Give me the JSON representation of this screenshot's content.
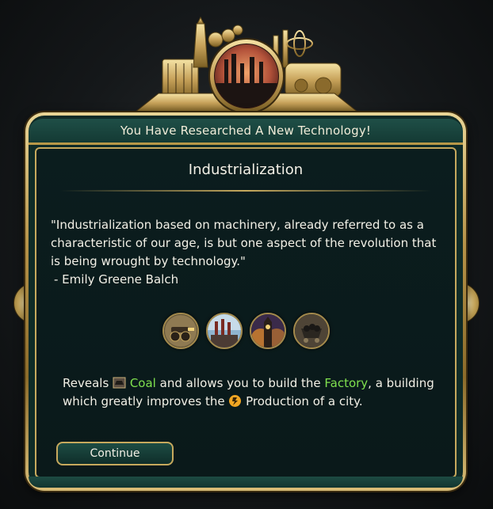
{
  "header": {
    "title": "You Have Researched A New Technology!"
  },
  "tech": {
    "name": "Industrialization"
  },
  "quote": {
    "text": "\"Industrialization based on machinery, already referred to as a characteristic of our age, is but one aspect of the revolution that is being wrought by technology.\"",
    "author": " - Emily Greene Balch"
  },
  "unlocks": [
    {
      "icon": "gatling-gun-icon"
    },
    {
      "icon": "factory-icon"
    },
    {
      "icon": "big-ben-icon"
    },
    {
      "icon": "coal-cart-icon"
    }
  ],
  "reveals": {
    "prefix": "Reveals",
    "resource": "Coal",
    "middle": "and allows you to build the",
    "building": "Factory",
    "suffix": ", a building which greatly improves the",
    "yield": "Production of a city."
  },
  "buttons": {
    "continue": "Continue"
  },
  "colors": {
    "accent_gold": "#c7a95d",
    "highlight_green": "#7fe04e",
    "panel_teal": "#0f2b27"
  }
}
